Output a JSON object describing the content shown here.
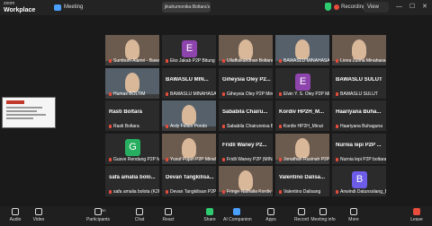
{
  "app": {
    "brand_line1": "zoom",
    "brand_line2": "Workplace"
  },
  "topbar": {
    "meeting_label": "Meeting",
    "share_label": "jikahumonika-Boltara's screen",
    "recording_label": "Recording",
    "view_label": "View"
  },
  "grid": {
    "tiles": [
      {
        "type": "video",
        "name": "Sumbum Alamri - Bawaslu B..."
      },
      {
        "type": "letter",
        "letter": "E",
        "color": "#8e44ad",
        "name": "Eko Jakab P2P Bitung"
      },
      {
        "type": "video",
        "name": "Ullaffulkahdhan Boltara"
      },
      {
        "type": "video",
        "name": "BAWASLU MINAHASA..."
      },
      {
        "type": "video",
        "name": "Liona Zulma Minahasa"
      },
      {
        "type": "video",
        "name": "Humas BOLTIM"
      },
      {
        "type": "text",
        "big": "BAWASLU MIN...",
        "name": "BAWASLU MINAHASA U..."
      },
      {
        "type": "text",
        "big": "Giheysia Oley P2...",
        "name": "Giheysia Oley P2P Mina..."
      },
      {
        "type": "letter",
        "letter": "E",
        "color": "#8e44ad",
        "name": "Elvin Y. S. Oley P2P Mi..."
      },
      {
        "type": "text",
        "big": "BAWASLU SULUT",
        "name": "BAWASLU SULUT"
      },
      {
        "type": "text",
        "big": "Rasti Boltara",
        "name": "Rasti Boltara"
      },
      {
        "type": "video",
        "name": "Ardy Fellen Pondo"
      },
      {
        "type": "text",
        "big": "Sababila Chairu...",
        "name": "Sababila Chairunnisa B..."
      },
      {
        "type": "text",
        "big": "Kordiv HP2H_M...",
        "name": "Kordiv HP2H_Minut"
      },
      {
        "type": "text",
        "big": "Haariyana Buha...",
        "name": "Haariyana Buhaguna"
      },
      {
        "type": "letter",
        "letter": "G",
        "color": "#27ae60",
        "name": "Gusve Rendang P2P Mina..."
      },
      {
        "type": "video",
        "name": "Yusuf Pujari P2P Minahas..."
      },
      {
        "type": "text",
        "big": "Fridli Waney P2...",
        "name": "Fridli Waney P2P (MINA..."
      },
      {
        "type": "video",
        "name": "Jonathan Rusinah P2P Mi..."
      },
      {
        "type": "text",
        "big": "Nurnia lepi P2P ...",
        "name": "Nurnia lepi P2P boltara"
      },
      {
        "type": "text",
        "big": "safa amalia bolo...",
        "name": "safa amalia bolota (K2P..."
      },
      {
        "type": "text",
        "big": "Devan Tangkilisa...",
        "name": "Devan Tangkilisan P2P ..."
      },
      {
        "type": "video",
        "name": "Fringe Nathalia Kordiv H..."
      },
      {
        "type": "text",
        "big": "Valentino Dalisa...",
        "name": "Valentino Dalisang"
      },
      {
        "type": "letter",
        "letter": "B",
        "color": "#6c5ce7",
        "name": "Anwindi Datunsolang_B..."
      }
    ]
  },
  "toolbar": {
    "items": [
      {
        "key": "audio",
        "label": "Audio"
      },
      {
        "key": "video",
        "label": "Video"
      },
      {
        "key": "participants",
        "label": "Participants",
        "badge": "50"
      },
      {
        "key": "chat",
        "label": "Chat"
      },
      {
        "key": "react",
        "label": "React"
      },
      {
        "key": "share",
        "label": "Share"
      },
      {
        "key": "ai",
        "label": "AI Companion"
      },
      {
        "key": "apps",
        "label": "Apps"
      },
      {
        "key": "record",
        "label": "Record"
      },
      {
        "key": "meeting_info",
        "label": "Meeting info"
      },
      {
        "key": "more",
        "label": "More"
      },
      {
        "key": "leave",
        "label": "Leave"
      }
    ]
  },
  "colors": {
    "share_green": "#2ecc71",
    "leave_red": "#e74c3c",
    "mic_muted": "#e74c3c"
  }
}
